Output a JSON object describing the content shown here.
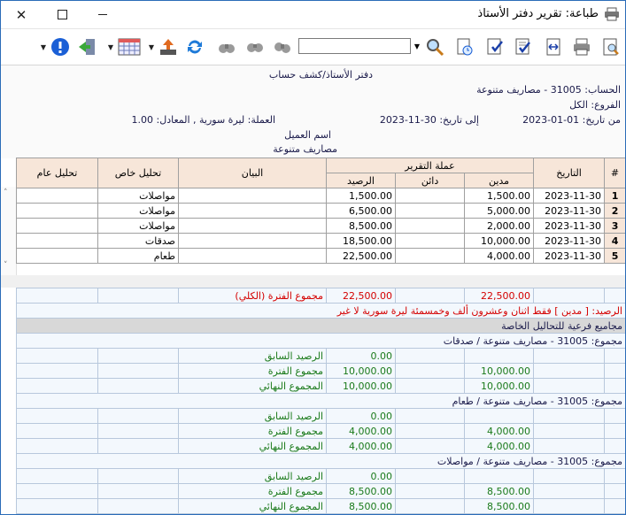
{
  "window": {
    "title": "طباعة: تقرير دفتر الأستاذ"
  },
  "toolbar": {
    "search_value": ""
  },
  "header": {
    "report_title": "دفتر الأستاذ/كشف حساب",
    "account": "الحساب: 31005 - مصاريف متنوعة",
    "branches": "الفروع: الكل",
    "from_label": "من تاريخ: 01-01-2023",
    "to_label": "إلى تاريخ: 30-11-2023",
    "currency": "العملة: ليرة سورية , المعادل: 1.00",
    "customer_name": "اسم العميل",
    "account_name": "مصاريف متنوعة"
  },
  "table": {
    "h_hash": "#",
    "h_date": "التاريخ",
    "h_currency": "عملة التقرير",
    "h_debit": "مدين",
    "h_credit": "دائن",
    "h_balance": "الرصيد",
    "h_statement": "البيان",
    "h_special": "تحليل خاص",
    "h_general": "تحليل عام",
    "rows": [
      {
        "n": "1",
        "date": "2023-11-30",
        "debit": "1,500.00",
        "credit": "",
        "balance": "1,500.00",
        "special": "مواصلات"
      },
      {
        "n": "2",
        "date": "2023-11-30",
        "debit": "5,000.00",
        "credit": "",
        "balance": "6,500.00",
        "special": "مواصلات"
      },
      {
        "n": "3",
        "date": "2023-11-30",
        "debit": "2,000.00",
        "credit": "",
        "balance": "8,500.00",
        "special": "مواصلات"
      },
      {
        "n": "4",
        "date": "2023-11-30",
        "debit": "10,000.00",
        "credit": "",
        "balance": "18,500.00",
        "special": "صدقات"
      },
      {
        "n": "5",
        "date": "2023-11-30",
        "debit": "4,000.00",
        "credit": "",
        "balance": "22,500.00",
        "special": "طعام"
      }
    ]
  },
  "summary": {
    "total_debit": "22,500.00",
    "total_balance": "22,500.00",
    "total_label": "مجموع الفترة (الكلي)",
    "balance_text": "الرصيد: [ مدين ] فقط اثنان وعشرون ألف وخمسمئة ليرة سورية لا غير",
    "subtotals_title": "مجاميع فرعية للتحاليل الخاصة",
    "prev_label": "الرصيد السابق",
    "period_label": "مجموع الفترة",
    "final_label": "المجموع النهائي",
    "groups": [
      {
        "title": "مجموع: 31005 - مصاريف متنوعة / صدقات",
        "prev": "0.00",
        "period_debit": "10,000.00",
        "period_balance": "10,000.00",
        "final_debit": "10,000.00",
        "final_balance": "10,000.00"
      },
      {
        "title": "مجموع: 31005 - مصاريف متنوعة / طعام",
        "prev": "0.00",
        "period_debit": "4,000.00",
        "period_balance": "4,000.00",
        "final_debit": "4,000.00",
        "final_balance": "4,000.00"
      },
      {
        "title": "مجموع: 31005 - مصاريف متنوعة / مواصلات",
        "prev": "0.00",
        "period_debit": "8,500.00",
        "period_balance": "8,500.00",
        "final_debit": "8,500.00",
        "final_balance": "8,500.00"
      }
    ]
  }
}
